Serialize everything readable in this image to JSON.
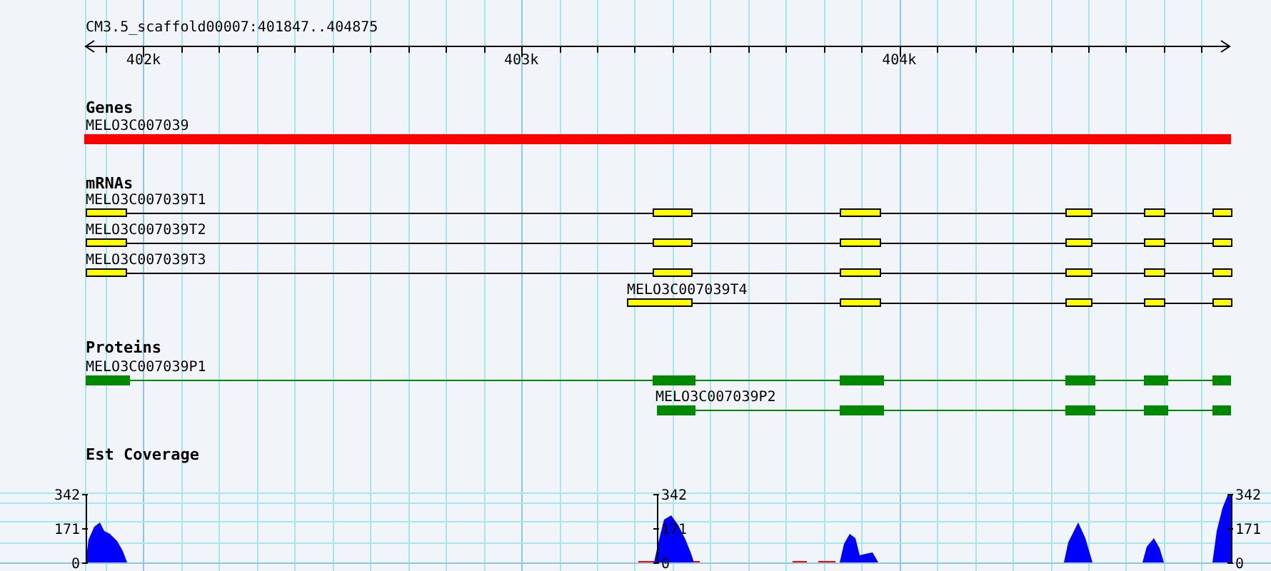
{
  "ruler": {
    "title": "CM3.5_scaffold00007:401847..404875",
    "ticks": [
      "402k",
      "403k",
      "404k"
    ]
  },
  "tracks": [
    {
      "kind": "gene",
      "heading": "Genes",
      "features": [
        {
          "label": "MELO3C007039"
        }
      ]
    },
    {
      "kind": "mrna",
      "heading": "mRNAs",
      "features": [
        {
          "label": "MELO3C007039T1"
        },
        {
          "label": "MELO3C007039T2"
        },
        {
          "label": "MELO3C007039T3"
        },
        {
          "label": "MELO3C007039T4"
        }
      ]
    },
    {
      "kind": "protein",
      "heading": "Proteins",
      "features": [
        {
          "label": "MELO3C007039P1"
        },
        {
          "label": "MELO3C007039P2"
        }
      ]
    },
    {
      "kind": "coverage",
      "heading": "Est Coverage",
      "axes": [
        {
          "ticks": [
            "342",
            "171",
            "0"
          ]
        },
        {
          "ticks": [
            "342",
            "171",
            "0"
          ]
        },
        {
          "ticks": [
            "342",
            "171",
            "0"
          ]
        }
      ]
    }
  ]
}
